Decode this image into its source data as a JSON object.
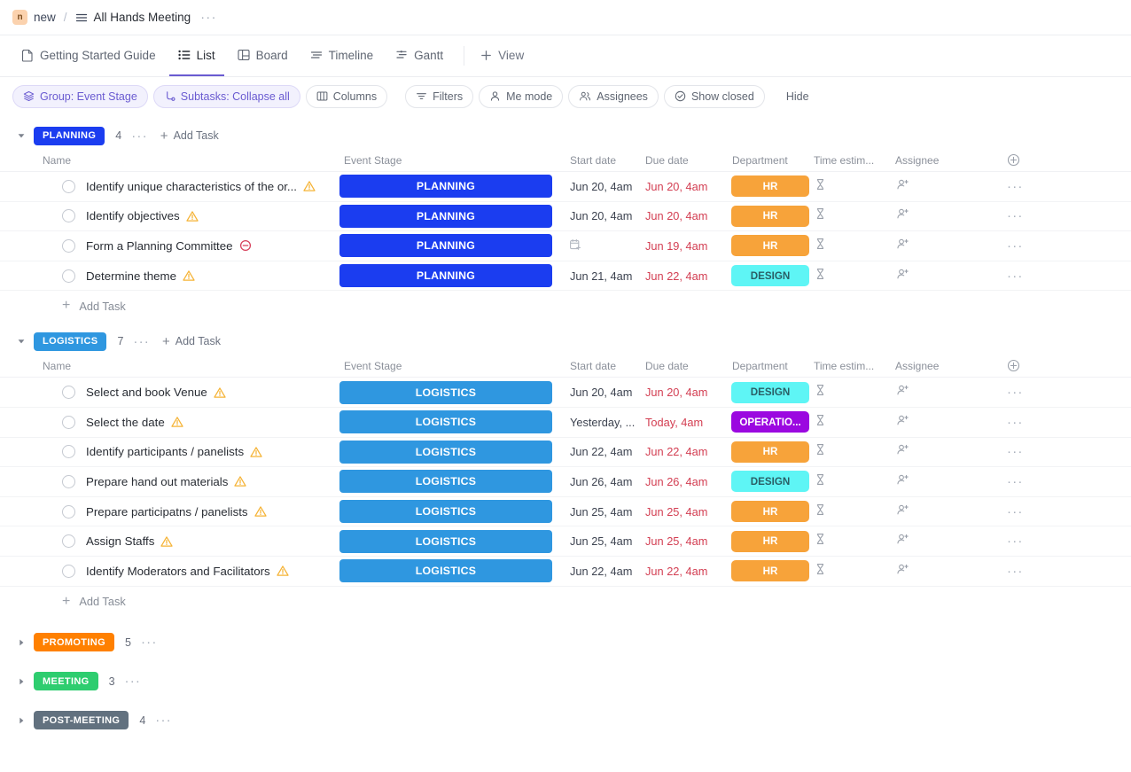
{
  "breadcrumb": {
    "avatar_letter": "n",
    "workspace": "new",
    "separator": "/",
    "list_icon": "list-lines-icon",
    "title": "All Hands Meeting",
    "more": "···"
  },
  "view_tabs": [
    {
      "label": "Getting Started Guide",
      "icon": "doc-icon",
      "active": false
    },
    {
      "label": "List",
      "icon": "list-icon",
      "active": true
    },
    {
      "label": "Board",
      "icon": "board-icon",
      "active": false
    },
    {
      "label": "Timeline",
      "icon": "timeline-icon",
      "active": false
    },
    {
      "label": "Gantt",
      "icon": "gantt-icon",
      "active": false
    }
  ],
  "add_view": {
    "label": "View",
    "icon": "plus-icon"
  },
  "toolbar": [
    {
      "label": "Group: Event Stage",
      "icon": "layers-icon",
      "style": "accent"
    },
    {
      "label": "Subtasks: Collapse all",
      "icon": "subtask-icon",
      "style": "accent"
    },
    {
      "label": "Columns",
      "icon": "columns-icon",
      "style": "outlined"
    },
    {
      "label": "Filters",
      "icon": "filter-icon",
      "style": "outlined"
    },
    {
      "label": "Me mode",
      "icon": "person-icon",
      "style": "outlined"
    },
    {
      "label": "Assignees",
      "icon": "people-icon",
      "style": "outlined"
    },
    {
      "label": "Show closed",
      "icon": "check-circle-icon",
      "style": "outlined"
    },
    {
      "label": "Hide",
      "icon": "none",
      "style": "plain"
    }
  ],
  "columns": {
    "name": "Name",
    "stage": "Event Stage",
    "start": "Start date",
    "due": "Due date",
    "department": "Department",
    "time": "Time estim...",
    "assignee": "Assignee",
    "add": "add-column-icon"
  },
  "add_task_label": "Add Task",
  "colors": {
    "planning": "#1b3df0",
    "logistics": "#2f97e0",
    "promoting": "#ff8000",
    "meeting": "#2ecd6f",
    "post_meeting": "#62717f",
    "hr": "#f7a33a",
    "hr_text": "#ffffff",
    "design": "#5ef5f5",
    "design_text": "#2a5f66",
    "operations": "#9b08e0",
    "operations_text": "#ffffff",
    "due_red": "#d33e52",
    "accent_purple": "#6a5bd1"
  },
  "groups": [
    {
      "name": "PLANNING",
      "color": "#1b3df0",
      "count": "4",
      "expanded": true,
      "tasks": [
        {
          "name": "Identify unique characteristics of the or...",
          "flag": "warning-triangle-icon",
          "stage": "PLANNING",
          "stage_color": "#1b3df0",
          "start": "Jun 20, 4am",
          "due": "Jun 20, 4am",
          "department": "HR",
          "dept_bg": "#f7a33a",
          "dept_fg": "#ffffff"
        },
        {
          "name": "Identify objectives",
          "flag": "warning-triangle-icon",
          "stage": "PLANNING",
          "stage_color": "#1b3df0",
          "start": "Jun 20, 4am",
          "due": "Jun 20, 4am",
          "department": "HR",
          "dept_bg": "#f7a33a",
          "dept_fg": "#ffffff"
        },
        {
          "name": "Form a Planning Committee",
          "flag": "blocked-circle-icon",
          "stage": "PLANNING",
          "stage_color": "#1b3df0",
          "start": "",
          "start_icon": "calendar-plus-icon",
          "due": "Jun 19, 4am",
          "department": "HR",
          "dept_bg": "#f7a33a",
          "dept_fg": "#ffffff"
        },
        {
          "name": "Determine theme",
          "flag": "warning-triangle-icon",
          "stage": "PLANNING",
          "stage_color": "#1b3df0",
          "start": "Jun 21, 4am",
          "due": "Jun 22, 4am",
          "department": "DESIGN",
          "dept_bg": "#5ef5f5",
          "dept_fg": "#2a5f66"
        }
      ]
    },
    {
      "name": "LOGISTICS",
      "color": "#2f97e0",
      "count": "7",
      "expanded": true,
      "tasks": [
        {
          "name": "Select and book Venue",
          "flag": "warning-triangle-icon",
          "stage": "LOGISTICS",
          "stage_color": "#2f97e0",
          "start": "Jun 20, 4am",
          "due": "Jun 20, 4am",
          "department": "DESIGN",
          "dept_bg": "#5ef5f5",
          "dept_fg": "#2a5f66"
        },
        {
          "name": "Select the date",
          "flag": "warning-triangle-icon",
          "stage": "LOGISTICS",
          "stage_color": "#2f97e0",
          "start": "Yesterday, ...",
          "due": "Today, 4am",
          "department": "OPERATIO...",
          "dept_bg": "#9b08e0",
          "dept_fg": "#ffffff"
        },
        {
          "name": "Identify participants / panelists",
          "flag": "warning-triangle-icon",
          "stage": "LOGISTICS",
          "stage_color": "#2f97e0",
          "start": "Jun 22, 4am",
          "due": "Jun 22, 4am",
          "department": "HR",
          "dept_bg": "#f7a33a",
          "dept_fg": "#ffffff"
        },
        {
          "name": "Prepare hand out materials",
          "flag": "warning-triangle-icon",
          "stage": "LOGISTICS",
          "stage_color": "#2f97e0",
          "start": "Jun 26, 4am",
          "due": "Jun 26, 4am",
          "department": "DESIGN",
          "dept_bg": "#5ef5f5",
          "dept_fg": "#2a5f66"
        },
        {
          "name": "Prepare participatns / panelists",
          "flag": "warning-triangle-icon",
          "stage": "LOGISTICS",
          "stage_color": "#2f97e0",
          "start": "Jun 25, 4am",
          "due": "Jun 25, 4am",
          "department": "HR",
          "dept_bg": "#f7a33a",
          "dept_fg": "#ffffff"
        },
        {
          "name": "Assign Staffs",
          "flag": "warning-triangle-icon",
          "stage": "LOGISTICS",
          "stage_color": "#2f97e0",
          "start": "Jun 25, 4am",
          "due": "Jun 25, 4am",
          "department": "HR",
          "dept_bg": "#f7a33a",
          "dept_fg": "#ffffff"
        },
        {
          "name": "Identify Moderators and Facilitators",
          "flag": "warning-triangle-icon",
          "stage": "LOGISTICS",
          "stage_color": "#2f97e0",
          "start": "Jun 22, 4am",
          "due": "Jun 22, 4am",
          "department": "HR",
          "dept_bg": "#f7a33a",
          "dept_fg": "#ffffff"
        }
      ]
    },
    {
      "name": "PROMOTING",
      "color": "#ff8000",
      "count": "5",
      "expanded": false,
      "tasks": []
    },
    {
      "name": "MEETING",
      "color": "#2ecd6f",
      "count": "3",
      "expanded": false,
      "tasks": []
    },
    {
      "name": "POST-MEETING",
      "color": "#62717f",
      "count": "4",
      "expanded": false,
      "tasks": []
    }
  ]
}
